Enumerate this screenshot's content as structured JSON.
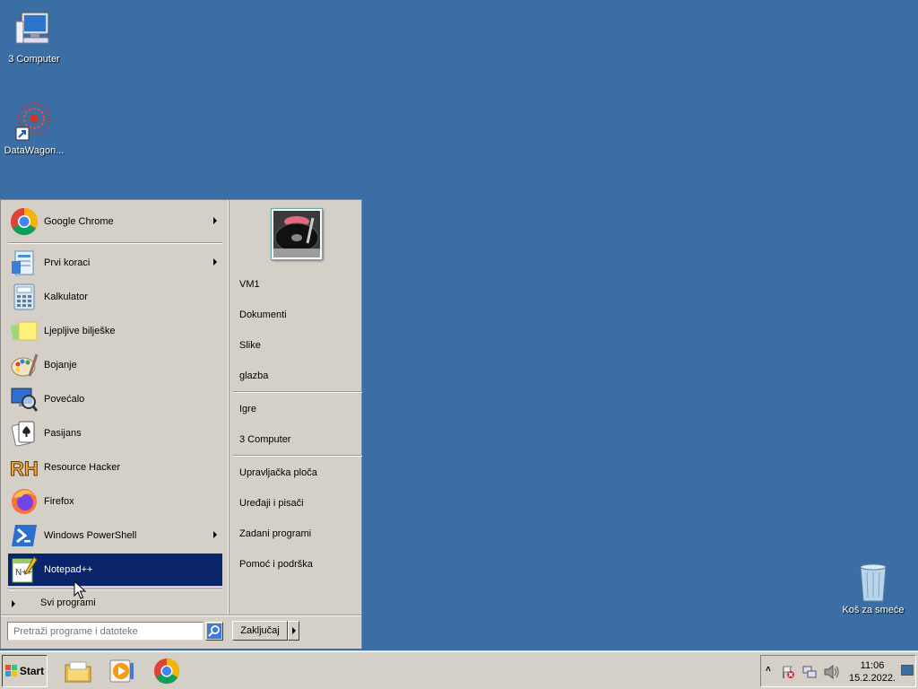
{
  "desktop": {
    "icons": [
      {
        "label": "3 Computer",
        "icon": "computer-icon"
      },
      {
        "label": "DataWagon...",
        "icon": "datawagon-icon"
      },
      {
        "label": "Koš za smeće",
        "icon": "recycle-bin-icon"
      }
    ]
  },
  "start_menu": {
    "pinned": {
      "label": "Google Chrome",
      "icon": "chrome-icon",
      "has_submenu": true
    },
    "recent": [
      {
        "label": "Prvi koraci",
        "icon": "getting-started-icon",
        "has_submenu": true
      },
      {
        "label": "Kalkulator",
        "icon": "calculator-icon",
        "has_submenu": false
      },
      {
        "label": "Ljepljive bilješke",
        "icon": "sticky-notes-icon",
        "has_submenu": false
      },
      {
        "label": "Bojanje",
        "icon": "paint-icon",
        "has_submenu": false
      },
      {
        "label": "Povećalo",
        "icon": "magnifier-icon",
        "has_submenu": false
      },
      {
        "label": "Pasijans",
        "icon": "solitaire-icon",
        "has_submenu": false
      },
      {
        "label": "Resource Hacker",
        "icon": "resource-hacker-icon",
        "has_submenu": false
      },
      {
        "label": "Firefox",
        "icon": "firefox-icon",
        "has_submenu": false
      },
      {
        "label": "Windows PowerShell",
        "icon": "powershell-icon",
        "has_submenu": true
      },
      {
        "label": "Notepad++",
        "icon": "notepad-plus-plus-icon",
        "has_submenu": false,
        "selected": true
      }
    ],
    "all_programs": "Svi programi",
    "search_placeholder": "Pretraži programe i datoteke",
    "right": {
      "group1": [
        "VM1",
        "Dokumenti",
        "Slike",
        "glazba"
      ],
      "group2": [
        "Igre",
        "3 Computer"
      ],
      "group3": [
        "Upravljačka ploča",
        "Uređaji i pisači",
        "Zadani programi",
        "Pomoć i podrška"
      ]
    },
    "lock_button": "Zaključaj"
  },
  "taskbar": {
    "start_label": "Start",
    "pinned": [
      "file-explorer-icon",
      "media-player-icon",
      "chrome-icon"
    ],
    "clock": {
      "time": "11:06",
      "date": "15.2.2022."
    }
  },
  "colors": {
    "desktop": "#3a6ea5",
    "selection": "#0a246a",
    "panel": "#d4d0c8"
  }
}
